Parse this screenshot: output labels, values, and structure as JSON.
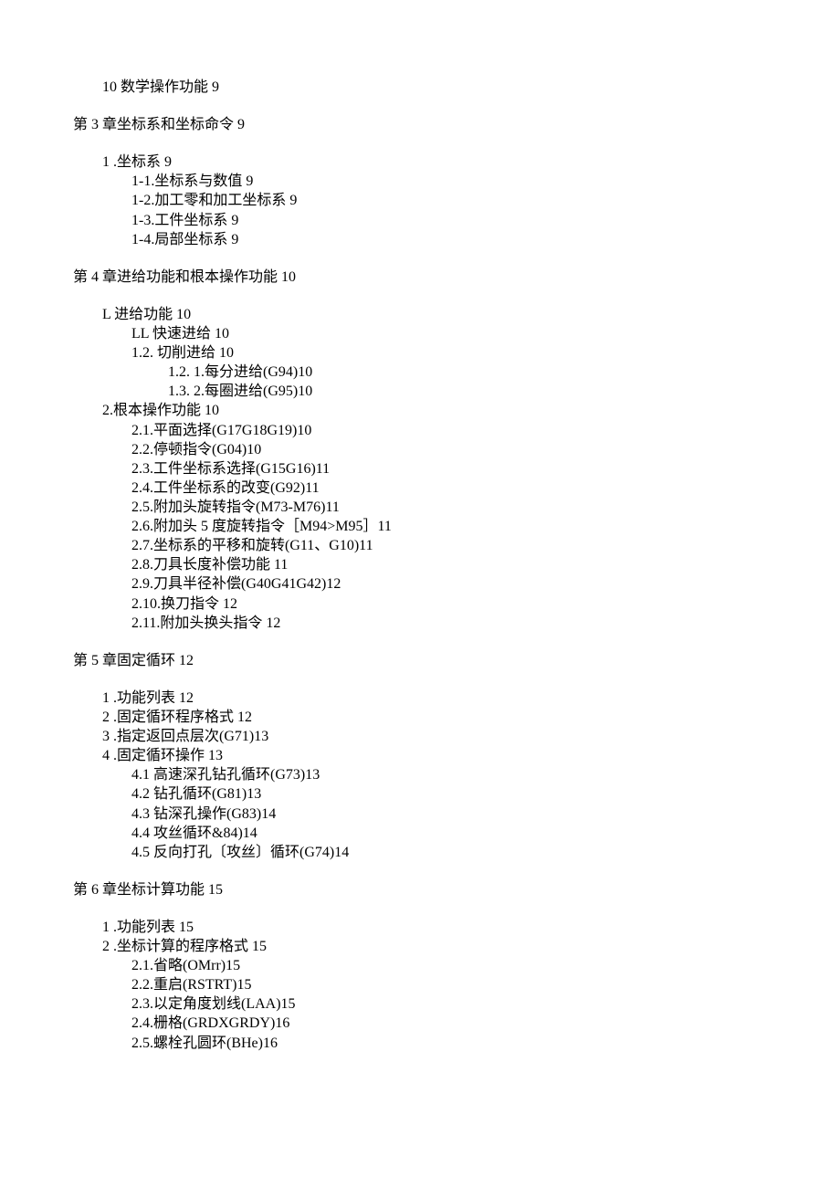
{
  "lines": [
    {
      "text": "10 数学操作功能 9",
      "level": "l1",
      "cls": "block-bottom"
    },
    {
      "text": "第 3 章坐标系和坐标命令 9",
      "level": "l0",
      "cls": "chapter"
    },
    {
      "text": "1 .坐标系 9",
      "level": "l1",
      "cls": "block-top"
    },
    {
      "text": "1-1.坐标系与数值 9",
      "level": "l2"
    },
    {
      "text": "1-2.加工零和加工坐标系 9",
      "level": "l2"
    },
    {
      "text": "1-3.工件坐标系 9",
      "level": "l2"
    },
    {
      "text": "1-4.局部坐标系 9",
      "level": "l2",
      "cls": "block-bottom"
    },
    {
      "text": "第 4 章进给功能和根本操作功能 10",
      "level": "l0",
      "cls": "chapter"
    },
    {
      "text": "L 进给功能 10",
      "level": "l1",
      "cls": "block-top"
    },
    {
      "text": "LL 快速进给 10",
      "level": "l2"
    },
    {
      "text": "1.2.  切削进给 10",
      "level": "l2"
    },
    {
      "text": "1.2. 1.每分进给(G94)10",
      "level": "l4"
    },
    {
      "text": "1.3. 2.每圈进给(G95)10",
      "level": "l4"
    },
    {
      "text": "2.根本操作功能 10",
      "level": "l1"
    },
    {
      "text": "2.1.平面选择(G17G18G19)10",
      "level": "l3"
    },
    {
      "text": "2.2.停顿指令(G04)10",
      "level": "l3"
    },
    {
      "text": "2.3.工件坐标系选择(G15G16)11",
      "level": "l3"
    },
    {
      "text": "2.4.工件坐标系的改变(G92)11",
      "level": "l3"
    },
    {
      "text": "2.5.附加头旋转指令(M73-M76)11",
      "level": "l3"
    },
    {
      "text": "2.6.附加头 5 度旋转指令［M94>M95］11",
      "level": "l3"
    },
    {
      "text": "2.7.坐标系的平移和旋转(G11、G10)11",
      "level": "l3"
    },
    {
      "text": "2.8.刀具长度补偿功能 11",
      "level": "l3"
    },
    {
      "text": "2.9.刀具半径补偿(G40G41G42)12",
      "level": "l3"
    },
    {
      "text": "2.10.换刀指令 12",
      "level": "l3"
    },
    {
      "text": "2.11.附加头换头指令 12",
      "level": "l3",
      "cls": "block-bottom"
    },
    {
      "text": "第 5 章固定循环 12",
      "level": "l0",
      "cls": "chapter"
    },
    {
      "text": "1 .功能列表 12",
      "level": "l1",
      "cls": "block-top"
    },
    {
      "text": "2 .固定循环程序格式 12",
      "level": "l1"
    },
    {
      "text": "3 .指定返回点层次(G71)13",
      "level": "l1"
    },
    {
      "text": "4 .固定循环操作 13",
      "level": "l1"
    },
    {
      "text": "4.1 高速深孔钻孔循环(G73)13",
      "level": "l3"
    },
    {
      "text": "4.2 钻孔循环(G81)13",
      "level": "l3"
    },
    {
      "text": "4.3 钻深孔操作(G83)14",
      "level": "l3"
    },
    {
      "text": "4.4 攻丝循环&84)14",
      "level": "l3"
    },
    {
      "text": "4.5 反向打孔〔攻丝〕循环(G74)14",
      "level": "l3",
      "cls": "block-bottom"
    },
    {
      "text": "第 6 章坐标计算功能 15",
      "level": "l0",
      "cls": "chapter"
    },
    {
      "text": "1 .功能列表 15",
      "level": "l1",
      "cls": "block-top"
    },
    {
      "text": "2 .坐标计算的程序格式 15",
      "level": "l1"
    },
    {
      "text": "2.1.省略(OMrr)15",
      "level": "l3"
    },
    {
      "text": "2.2.重启(RSTRT)15",
      "level": "l3"
    },
    {
      "text": "2.3.以定角度划线(LAA)15",
      "level": "l3"
    },
    {
      "text": "2.4.栅格(GRDXGRDY)16",
      "level": "l3"
    },
    {
      "text": "2.5.螺栓孔圆环(BHe)16",
      "level": "l3"
    }
  ]
}
